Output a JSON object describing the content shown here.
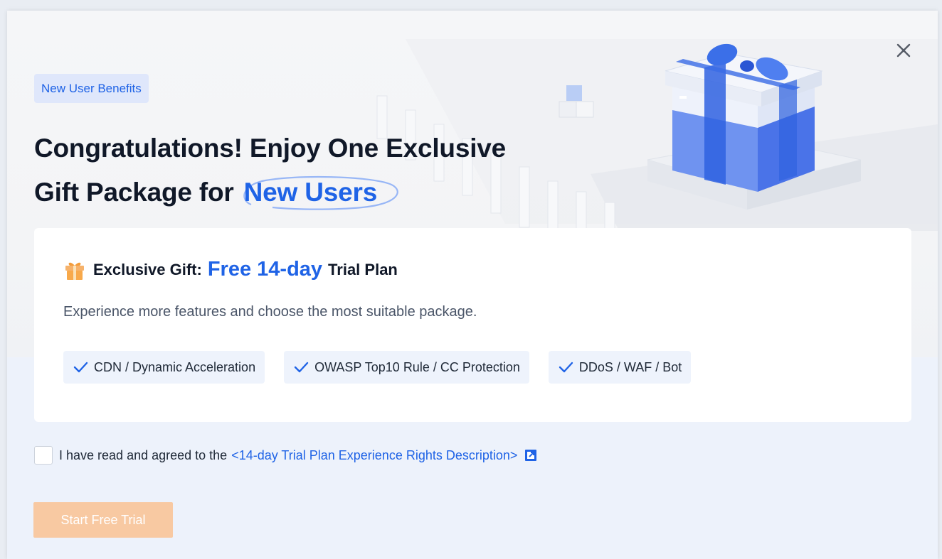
{
  "modal": {
    "tag": "New User Benefits",
    "headline_line1": "Congratulations! Enjoy One Exclusive",
    "headline_line2_prefix": "Gift Package for",
    "headline_highlight": "New Users",
    "close_icon": "close-icon"
  },
  "card": {
    "gift_prefix": "Exclusive Gift:",
    "gift_highlight": "Free 14-day",
    "gift_suffix": "Trial Plan",
    "description": "Experience more features and choose the most suitable package.",
    "features": [
      {
        "label": "CDN / Dynamic Acceleration",
        "icon": "check-icon"
      },
      {
        "label": "OWASP Top10 Rule / CC Protection",
        "icon": "check-icon"
      },
      {
        "label": "DDoS / WAF / Bot",
        "icon": "check-icon"
      }
    ]
  },
  "agreement": {
    "checked": false,
    "text": "I have read and agreed to the",
    "link_text": "<14-day Trial Plan Experience Rights Description>",
    "link_icon": "external-link-icon"
  },
  "actions": {
    "start_label": "Start Free Trial"
  },
  "colors": {
    "accent": "#1f63e6",
    "button_disabled": "#f8c9a2",
    "tag_bg": "#dfe7fb"
  }
}
